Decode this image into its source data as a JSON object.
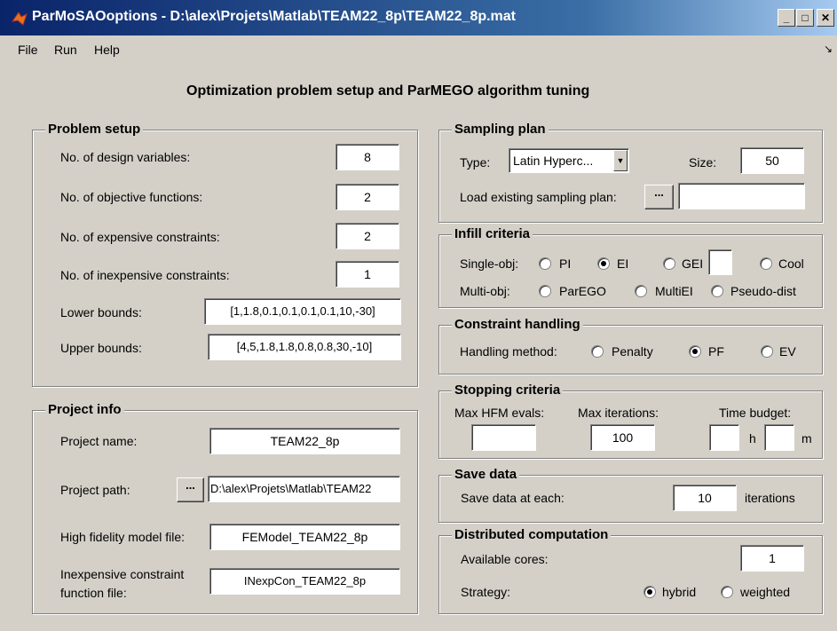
{
  "window": {
    "title": "ParMoSAOoptions - D:\\alex\\Projets\\Matlab\\TEAM22_8p\\TEAM22_8p.mat",
    "minimize_glyph": "_",
    "restore_glyph": "□",
    "close_glyph": "✕"
  },
  "menu": {
    "file": "File",
    "run": "Run",
    "help": "Help",
    "dock_glyph": "↘"
  },
  "heading": "Optimization problem setup and ParMEGO algorithm tuning",
  "problem_setup": {
    "title": "Problem setup",
    "design_vars_label": "No. of design variables:",
    "design_vars_value": "8",
    "objectives_label": "No. of objective functions:",
    "objectives_value": "2",
    "expensive_label": "No. of expensive constraints:",
    "expensive_value": "2",
    "inexpensive_label": "No. of inexpensive constraints:",
    "inexpensive_value": "1",
    "lower_label": "Lower bounds:",
    "lower_value": "[1,1.8,0.1,0.1,0.1,0.1,10,-30]",
    "upper_label": "Upper bounds:",
    "upper_value": "[4,5,1.8,1.8,0.8,0.8,30,-10]"
  },
  "project_info": {
    "title": "Project info",
    "name_label": "Project name:",
    "name_value": "TEAM22_8p",
    "path_label": "Project path:",
    "path_browse": "...",
    "path_value": "D:\\alex\\Projets\\Matlab\\TEAM22",
    "hf_label": "High fidelity model file:",
    "hf_value": "FEModel_TEAM22_8p",
    "inexp_label_1": "Inexpensive constraint",
    "inexp_label_2": "function file:",
    "inexp_value": "INexpCon_TEAM22_8p"
  },
  "sampling_plan": {
    "title": "Sampling plan",
    "type_label": "Type:",
    "type_value": "Latin Hyperc...",
    "size_label": "Size:",
    "size_value": "50",
    "load_label": "Load existing sampling plan:",
    "load_browse": "...",
    "load_value": ""
  },
  "infill": {
    "title": "Infill criteria",
    "single_label": "Single-obj:",
    "pi": "PI",
    "ei": "EI",
    "gei": "GEI",
    "gei_value": "",
    "cool": "Cool",
    "multi_label": "Multi-obj:",
    "parego": "ParEGO",
    "multiei": "MultiEI",
    "pseudo": "Pseudo-dist"
  },
  "constraint": {
    "title": "Constraint handling",
    "method_label": "Handling method:",
    "penalty": "Penalty",
    "pf": "PF",
    "ev": "EV"
  },
  "stopping": {
    "title": "Stopping criteria",
    "hfm_label": "Max HFM evals:",
    "hfm_value": "",
    "iter_label": "Max iterations:",
    "iter_value": "100",
    "time_label": "Time budget:",
    "hours_value": "",
    "h": "h",
    "minutes_value": "",
    "m": "m"
  },
  "save": {
    "title": "Save data",
    "label": "Save data at each:",
    "value": "10",
    "suffix": "iterations"
  },
  "distributed": {
    "title": "Distributed computation",
    "cores_label": "Available cores:",
    "cores_value": "1",
    "strategy_label": "Strategy:",
    "hybrid": "hybrid",
    "weighted": "weighted"
  }
}
